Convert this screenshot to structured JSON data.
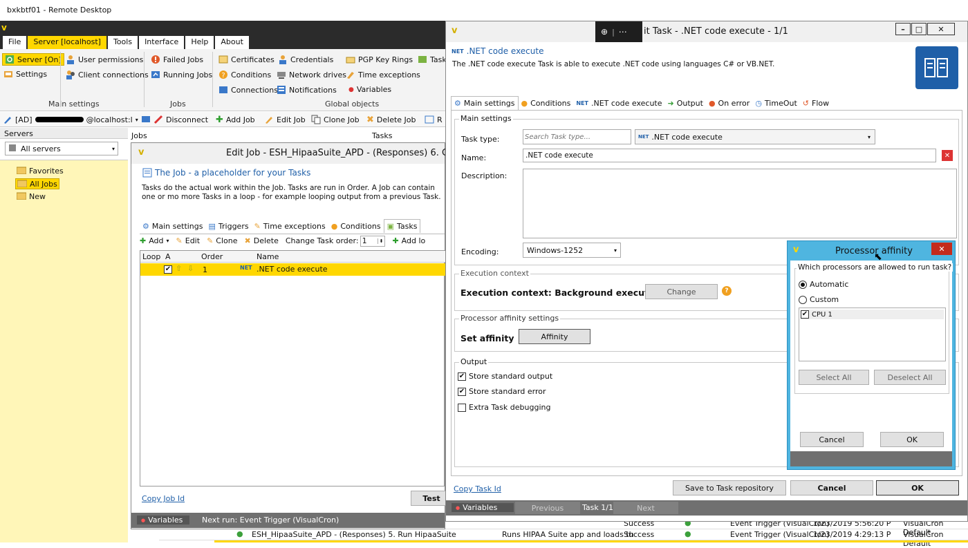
{
  "window_title": "bxkbtf01 - Remote Desktop",
  "main": {
    "menu": [
      "File",
      "Server [localhost]",
      "Tools",
      "Interface",
      "Help",
      "About"
    ],
    "ribbon": {
      "server_on": "Server [On]",
      "settings": "Settings",
      "user_permissions": "User permissions",
      "client_connections": "Client connections",
      "failed_jobs": "Failed Jobs",
      "running_jobs": "Running Jobs",
      "certificates": "Certificates",
      "credentials": "Credentials",
      "pgp": "PGP Key Rings",
      "task_partial": "Task",
      "conditions": "Conditions",
      "network_drives": "Network drives",
      "time_exceptions": "Time exceptions",
      "connections": "Connections",
      "notifications": "Notifications",
      "variables": "Variables",
      "group_main": "Main settings",
      "group_jobs": "Jobs",
      "group_global": "Global objects"
    },
    "toolbar": {
      "user_prefix": "[AD]",
      "user_suffix": "@localhost:l",
      "disconnect": "Disconnect",
      "add_job": "Add Job",
      "edit_job": "Edit Job",
      "clone_job": "Clone Job",
      "delete_job": "Delete Job",
      "partial": "R"
    },
    "servers_label": "Servers",
    "servers_select": "All servers",
    "jobs_label": "Jobs",
    "tasks_label": "Tasks",
    "tree": [
      "Favorites",
      "All Jobs",
      "New"
    ],
    "bg_rows": [
      {
        "c1": "Success",
        "c2": "Event Trigger (VisualCron)",
        "c3": "1/23/2019 5:56:20 P",
        "c4": "VisualCron Default"
      },
      {
        "name": "ESH_HipaaSuite_APD - (Responses) 5. Run HipaaSuite",
        "desc": "Runs HIPAA Suite app and loads th",
        "c1": "Success",
        "c2": "Event Trigger (VisualCron)",
        "c3": "1/23/2019 4:29:13 P",
        "c4": "VisualCron Default"
      }
    ]
  },
  "edit_job": {
    "title": "Edit Job - ESH_HipaaSuite_APD - (Responses) 6. Ge",
    "heading": "The Job - a placeholder for your Tasks",
    "desc": "Tasks do the actual work within the Job. Tasks are run in Order. A Job can contain one or mo more Tasks in a loop - for example looping output from a previous Task.",
    "tabs": [
      "Main settings",
      "Triggers",
      "Time exceptions",
      "Conditions",
      "Tasks"
    ],
    "toolbar": {
      "add": "Add",
      "edit": "Edit",
      "clone": "Clone",
      "delete": "Delete",
      "change_order": "Change Task order:",
      "order_value": "1",
      "add_lo": "Add lo"
    },
    "columns": [
      "Loop",
      "A",
      "Order",
      "Name"
    ],
    "row": {
      "order": "1",
      "name": ".NET code execute"
    },
    "copy_job_id": "Copy Job Id",
    "test": "Test",
    "variables": "Variables",
    "next_run": "Next run: Event Trigger (VisualCron)"
  },
  "edit_task": {
    "title": "it Task - .NET code execute - 1/1",
    "heading": ".NET code execute",
    "desc": "The .NET code execute Task is able to execute .NET code using languages C# or VB.NET.",
    "tabs": [
      "Main settings",
      "Conditions",
      ".NET code execute",
      "Output",
      "On error",
      "TimeOut",
      "Flow"
    ],
    "main_settings_group": "Main settings",
    "task_type_label": "Task type:",
    "task_type_placeholder": "Search Task type...",
    "task_type_value": ".NET code execute",
    "name_label": "Name:",
    "name_value": ".NET code execute",
    "description_label": "Description:",
    "encoding_label": "Encoding:",
    "encoding_value": "Windows-1252",
    "exec_group": "Execution context",
    "exec_text": "Execution context: Background execution",
    "change": "Change",
    "affinity_group": "Processor affinity settings",
    "set_affinity": "Set affinity",
    "affinity_btn": "Affinity",
    "output_group": "Output",
    "store_stdout": "Store standard output",
    "store_stderr": "Store standard error",
    "extra_debug": "Extra Task debugging",
    "copy_task_id": "Copy Task Id",
    "save_repo": "Save to Task repository",
    "cancel": "Cancel",
    "ok": "OK",
    "variables": "Variables",
    "previous": "Previous",
    "task_counter": "Task 1/1",
    "next": "Next"
  },
  "affinity_dialog": {
    "title": "Processor affinity",
    "question": "Which processors are allowed to run task?",
    "automatic": "Automatic",
    "custom": "Custom",
    "cpu": "CPU 1",
    "select_all": "Select All",
    "deselect_all": "Deselect All",
    "cancel": "Cancel",
    "ok": "OK"
  },
  "colors": {
    "accent": "#ffd700",
    "titlebar_blue": "#4fb5e0",
    "close_red": "#c42b1c",
    "dark_menu": "#2b2b2b",
    "ribbon_bg": "#f3f3f3",
    "tree_bg": "#fff6b8",
    "status_gray": "#707070"
  }
}
